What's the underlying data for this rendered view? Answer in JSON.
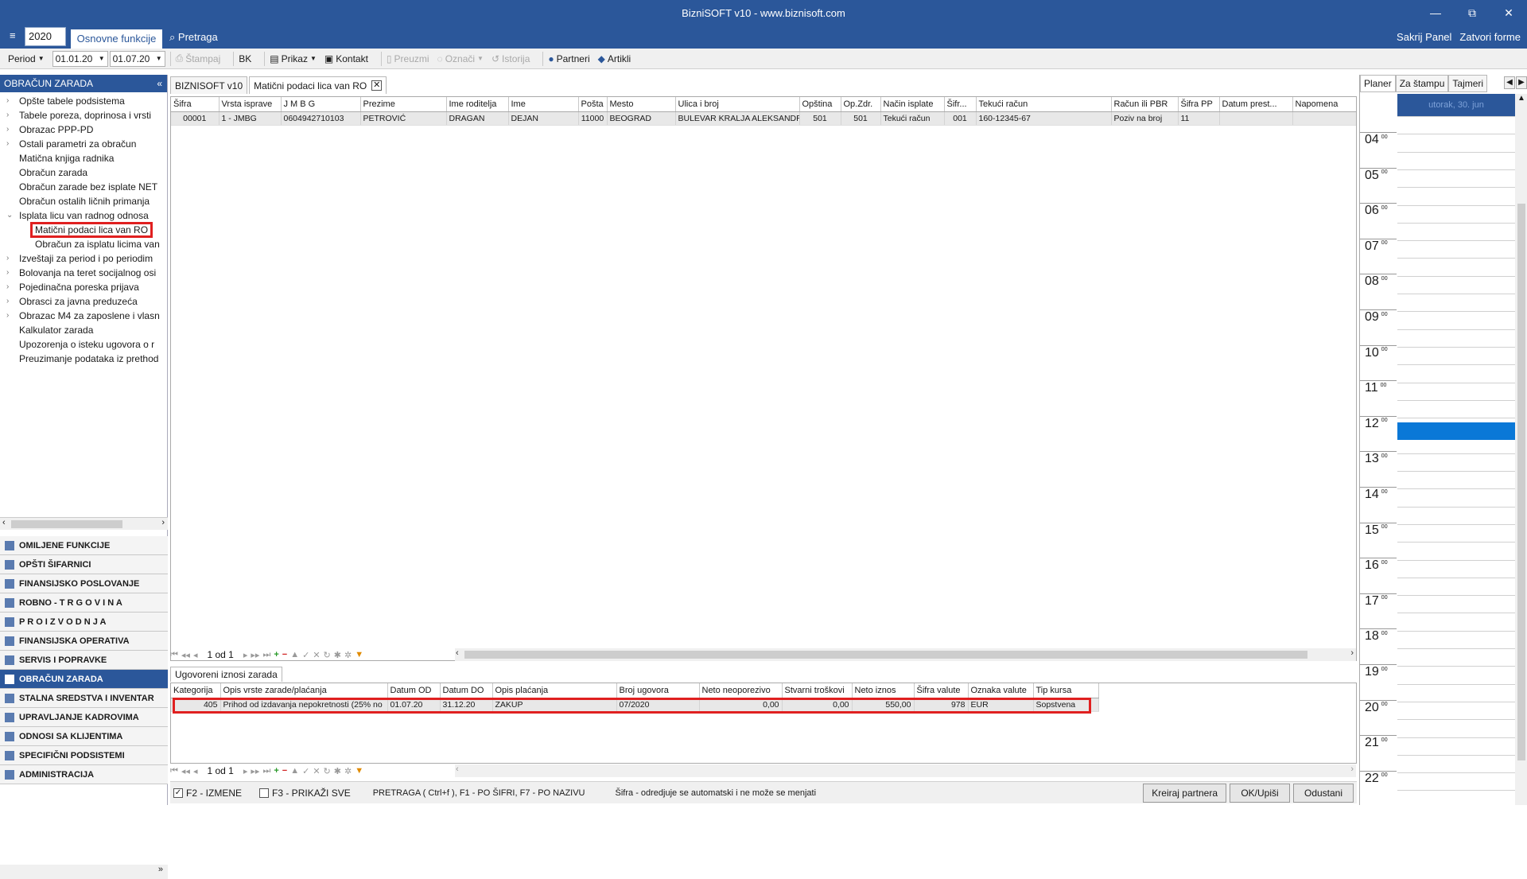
{
  "app": {
    "title": "BizniSOFT v10 - www.biznisoft.com",
    "minimize": "—",
    "restore": "⧉",
    "close": "✕"
  },
  "ribbon": {
    "year": "2020",
    "tab_active": "Osnovne funkcije",
    "search": "Pretraga",
    "hide_panel": "Sakrij Panel",
    "close_forms": "Zatvori forme"
  },
  "toolbar": {
    "period_label": "Period",
    "date_from": "01.01.20",
    "date_to": "01.07.20",
    "print": "Štampaj",
    "bk": "BK",
    "view": "Prikaz",
    "contact": "Kontakt",
    "take": "Preuzmi",
    "mark": "Označi",
    "history": "Istorija",
    "partners": "Partneri",
    "articles": "Artikli"
  },
  "leftpanel": {
    "header": "OBRAČUN ZARADA",
    "collapse": "«",
    "tree": [
      {
        "label": "Opšte tabele podsistema",
        "arrow": "›"
      },
      {
        "label": "Tabele poreza, doprinosa i vrsti",
        "arrow": "›"
      },
      {
        "label": "Obrazac PPP-PD",
        "arrow": "›"
      },
      {
        "label": "Ostali parametri za obračun",
        "arrow": "›"
      },
      {
        "label": "Matična knjiga radnika",
        "arrow": ""
      },
      {
        "label": "Obračun zarada",
        "arrow": ""
      },
      {
        "label": "Obračun zarade bez isplate NET",
        "arrow": ""
      },
      {
        "label": "Obračun ostalih ličnih primanja",
        "arrow": ""
      },
      {
        "label": "Isplata licu van radnog odnosa",
        "arrow": "⌄"
      },
      {
        "label": "Matični podaci lica van RO",
        "arrow": "",
        "sub": true,
        "sel": true
      },
      {
        "label": "Obračun za isplatu licima van",
        "arrow": "",
        "sub": true
      },
      {
        "label": "Izveštaji za period i po periodim",
        "arrow": "›"
      },
      {
        "label": "Bolovanja na teret socijalnog osi",
        "arrow": "›"
      },
      {
        "label": "Pojedinačna poreska prijava",
        "arrow": "›"
      },
      {
        "label": "Obrasci za javna preduzeća",
        "arrow": "›"
      },
      {
        "label": "Obrazac M4 za zaposlene i vlasn",
        "arrow": "›"
      },
      {
        "label": "Kalkulator zarada",
        "arrow": ""
      },
      {
        "label": "Upozorenja o isteku ugovora o r",
        "arrow": ""
      },
      {
        "label": "Preuzimanje podataka iz prethod",
        "arrow": ""
      }
    ],
    "modules": [
      {
        "label": "OMILJENE FUNKCIJE"
      },
      {
        "label": "OPŠTI ŠIFARNICI"
      },
      {
        "label": "FINANSIJSKO POSLOVANJE"
      },
      {
        "label": "ROBNO - T R G O V I N A"
      },
      {
        "label": "P R O I Z V O D N J A"
      },
      {
        "label": "FINANSIJSKA OPERATIVA"
      },
      {
        "label": "SERVIS I POPRAVKE"
      },
      {
        "label": "OBRAČUN ZARADA",
        "active": true
      },
      {
        "label": "STALNA SREDSTVA I INVENTAR"
      },
      {
        "label": "UPRAVLJANJE KADROVIMA"
      },
      {
        "label": "ODNOSI SA KLIJENTIMA"
      },
      {
        "label": "SPECIFIČNI PODSISTEMI"
      },
      {
        "label": "ADMINISTRACIJA"
      }
    ],
    "footer": "»"
  },
  "doctabs": {
    "tab1": "BIZNISOFT v10",
    "tab2": "Matični podaci lica van RO",
    "close": "✕"
  },
  "grid1": {
    "columns": [
      "Šifra",
      "Vrsta isprave",
      "J M B G",
      "Prezime",
      "Ime roditelja",
      "Ime",
      "Pošta",
      "Mesto",
      "Ulica i broj",
      "Opština",
      "Op.Zdr.",
      "Način isplate",
      "Šifr...",
      "Tekući račun",
      "Račun ili PBR",
      "Šifra PP",
      "Datum prest...",
      "Napomena"
    ],
    "rows": [
      [
        "00001",
        "1 - JMBG",
        "0604942710103",
        "PETROVIĆ",
        "DRAGAN",
        "DEJAN",
        "11000",
        "BEOGRAD",
        "BULEVAR KRALJA ALEKSANDRA",
        "501",
        "501",
        "Tekući račun",
        "001",
        "160-12345-67",
        "Poziv na broj",
        "11",
        "",
        ""
      ]
    ],
    "pager": "1 od 1"
  },
  "grid2": {
    "tab": "Ugovoreni iznosi zarada",
    "columns": [
      "Kategorija",
      "Opis vrste zarade/plaćanja",
      "Datum OD",
      "Datum DO",
      "Opis plaćanja",
      "Broj ugovora",
      "Neto neoporezivo",
      "Stvarni troškovi",
      "Neto iznos",
      "Šifra valute",
      "Oznaka valute",
      "Tip kursa"
    ],
    "rows": [
      [
        "405",
        "Prihod od izdavanja nepokretnosti (25% no",
        "01.07.20",
        "31.12.20",
        "ZAKUP",
        "07/2020",
        "0,00",
        "0,00",
        "550,00",
        "978",
        "EUR",
        "Sopstvena"
      ]
    ],
    "pager": "1 od 1"
  },
  "statusbar": {
    "f2": "F2 - IZMENE",
    "f3": "F3 - PRIKAŽI SVE",
    "search_hint": "PRETRAGA ( Ctrl+f ), F1 - PO ŠIFRI, F7 - PO NAZIVU",
    "info": "Šifra - odredjuje se automatski i ne može se menjati",
    "create": "Kreiraj partnera",
    "ok": "OK/Upiši",
    "cancel": "Odustani"
  },
  "rightpanel": {
    "tabs": [
      "Planer",
      "Za štampu",
      "Tajmeri"
    ],
    "day": "utorak, 30. jun",
    "hours": [
      "04",
      "05",
      "06",
      "07",
      "08",
      "09",
      "10",
      "11",
      "12",
      "13",
      "14",
      "15",
      "16",
      "17",
      "18",
      "19",
      "20",
      "21",
      "22"
    ],
    "minutes": "00"
  }
}
